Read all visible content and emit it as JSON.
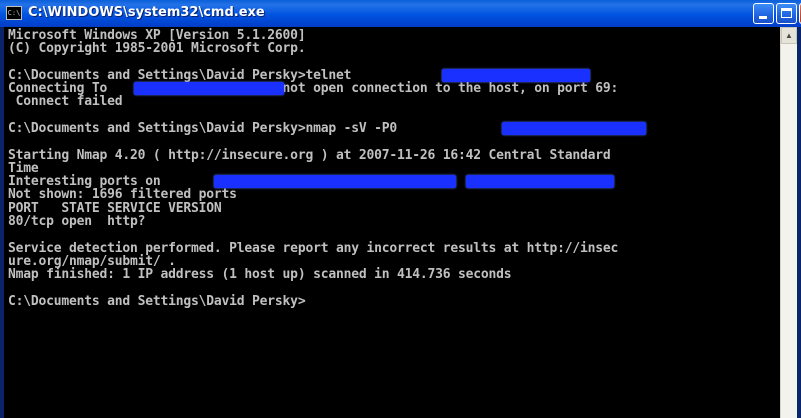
{
  "window": {
    "title": "C:\\WINDOWS\\system32\\cmd.exe",
    "icon": "console-window-icon",
    "icon_text": "C:\\",
    "buttons": {
      "minimize": "minimize-icon",
      "maximize": "maximize-icon",
      "close_label": "×"
    }
  },
  "console": {
    "text_color": "#c0c0c0",
    "background": "#000000",
    "lines": [
      "Microsoft Windows XP [Version 5.1.2600]",
      "(C) Copyright 1985-2001 Microsoft Corp.",
      "",
      "C:\\Documents and Settings\\David Persky>telnet                    69",
      "Connecting To              ...Could not open connection to the host, on port 69:",
      " Connect failed",
      "",
      "C:\\Documents and Settings\\David Persky>nmap -sV -P0",
      "",
      "Starting Nmap 4.20 ( http://insecure.org ) at 2007-11-26 16:42 Central Standard",
      "Time",
      "Interesting ports on",
      "Not shown: 1696 filtered ports",
      "PORT   STATE SERVICE VERSION",
      "80/tcp open  http?",
      "",
      "Service detection performed. Please report any incorrect results at http://insec",
      "ure.org/nmap/submit/ .",
      "Nmap finished: 1 IP address (1 host up) scanned in 414.736 seconds",
      "",
      "C:\\Documents and Settings\\David Persky>"
    ]
  },
  "redaction_color": "#1a30ff",
  "scrollbar": {
    "up_arrow": "scroll-up-arrow-icon",
    "up_glyph": "▲"
  }
}
